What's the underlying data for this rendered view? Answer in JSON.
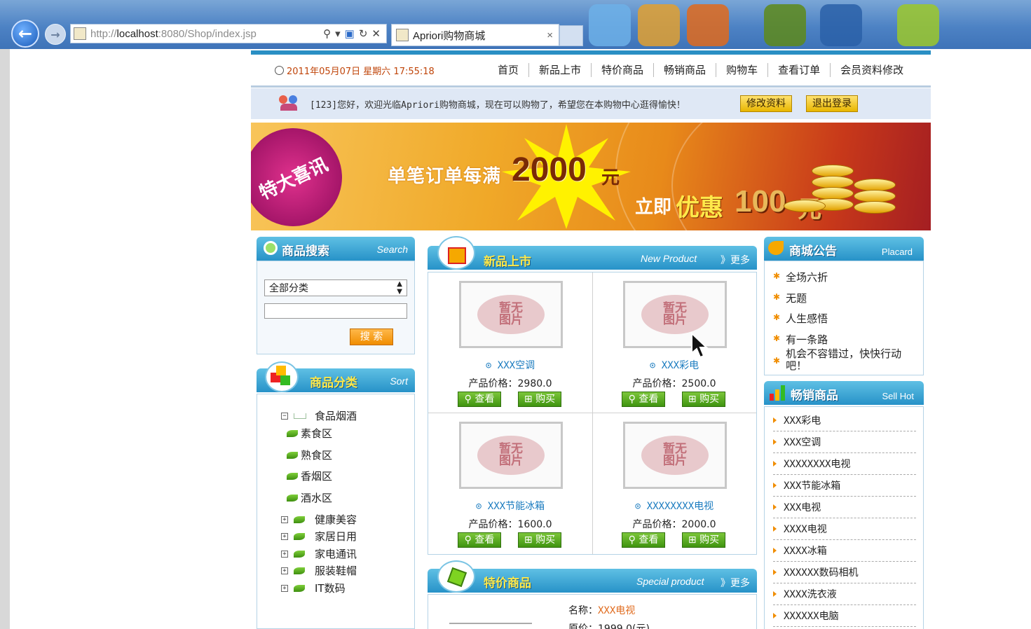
{
  "browser": {
    "url_prefix": "http://",
    "url_host": "localhost",
    "url_rest": ":8080/Shop/index.jsp",
    "tab_title": "Apriori购物商城",
    "tab_close": "×"
  },
  "header": {
    "datetime": "2011年05月07日 星期六 17:55:18",
    "nav": [
      "首页",
      "新品上市",
      "特价商品",
      "畅销商品",
      "购物车",
      "查看订单",
      "会员资料修改"
    ]
  },
  "welcome": {
    "text": "[123]您好，欢迎光临Apriori购物商城，现在可以购物了，希望您在本购物中心逛得愉快！",
    "edit_label": "修改资料",
    "logout_label": "退出登录"
  },
  "banner": {
    "badge": "特大喜讯",
    "line1": "单笔订单每满",
    "amount1": "2000",
    "yuan1": "元",
    "line2": "立即",
    "youhui": "优惠",
    "amount2": "100",
    "yuan2": "元"
  },
  "search": {
    "title": "商品搜索",
    "title_en": "Search",
    "category_selected": "全部分类",
    "input_value": "",
    "button": "搜 索"
  },
  "sort": {
    "title": "商品分类",
    "title_en": "Sort",
    "expanded": {
      "label": "食品烟酒",
      "children": [
        "素食区",
        "熟食区",
        "香烟区",
        "酒水区"
      ]
    },
    "collapsed": [
      "健康美容",
      "家居日用",
      "家电通讯",
      "服装鞋帽",
      "IT数码"
    ]
  },
  "new_products": {
    "title": "新品上市",
    "title_en": "New Product",
    "more": "》更多",
    "no_image": "暂无图片",
    "price_label": "产品价格：",
    "view_label": "查看",
    "buy_label": "购买",
    "items": [
      {
        "name": "XXX空调",
        "price": "2980.0"
      },
      {
        "name": "XXX彩电",
        "price": "2500.0"
      },
      {
        "name": "XXX节能冰箱",
        "price": "1600.0"
      },
      {
        "name": "XXXXXXXX电视",
        "price": "2000.0"
      }
    ]
  },
  "special": {
    "title": "特价商品",
    "title_en": "Special product",
    "more": "》更多",
    "name_label": "名称：",
    "name_value": "XXX电视",
    "price_label": "原价：",
    "price_value": "1999.0(元)"
  },
  "notice": {
    "title": "商城公告",
    "title_en": "Placard",
    "items": [
      "全场六折",
      "无题",
      "人生感悟",
      "有一条路",
      "机会不容错过，快快行动吧！"
    ]
  },
  "hot": {
    "title": "畅销商品",
    "title_en": "Sell Hot",
    "items": [
      "XXX彩电",
      "XXX空调",
      "XXXXXXXX电视",
      "XXX节能冰箱",
      "XXX电视",
      "XXXX电视",
      "XXXX冰箱",
      "XXXXXX数码相机",
      "XXXX洗衣液",
      "XXXXXX电脑"
    ]
  },
  "colors": {
    "accent": "#2792c8",
    "price_orange": "#c0450a",
    "button_green": "#3f9410"
  }
}
